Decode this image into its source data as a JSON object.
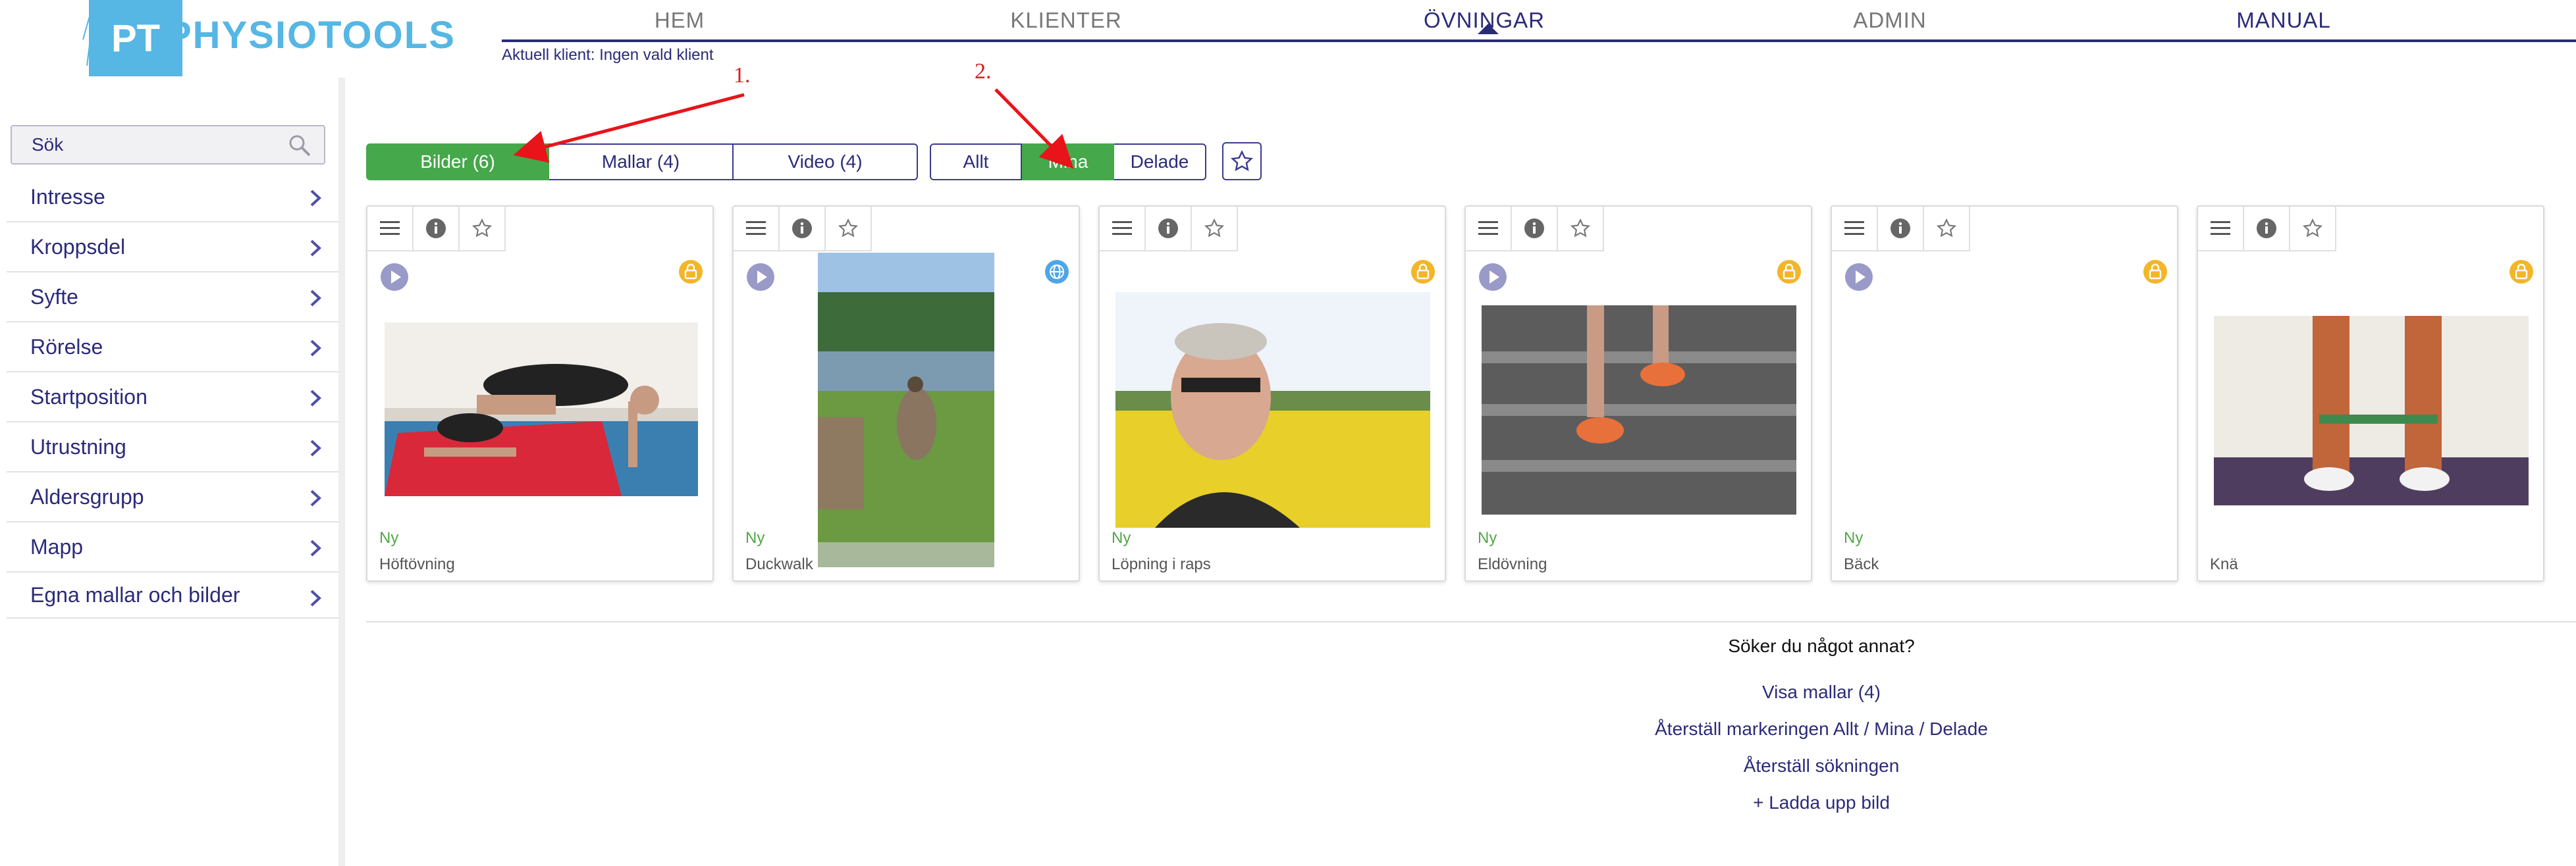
{
  "brand": {
    "logo_text": "PT",
    "name": "PHYSIOTOOLS"
  },
  "nav": {
    "items": [
      "HEM",
      "KLIENTER",
      "ÖVNINGAR",
      "ADMIN",
      "MANUAL"
    ],
    "active": "ÖVNINGAR"
  },
  "client_line": "Aktuell klient: Ingen vald klient",
  "search": {
    "label": "Sök"
  },
  "sidebar": {
    "items": [
      "Intresse",
      "Kroppsdel",
      "Syfte",
      "Rörelse",
      "Startposition",
      "Utrustning",
      "Aldersgrupp",
      "Mapp",
      "Egna mallar och bilder"
    ]
  },
  "media_tabs": [
    {
      "label": "Bilder (6)",
      "active": true
    },
    {
      "label": "Mallar (4)",
      "active": false
    },
    {
      "label": "Video (4)",
      "active": false
    }
  ],
  "owner_tabs": [
    {
      "label": "Allt",
      "active": false
    },
    {
      "label": "Mina",
      "active": true
    },
    {
      "label": "Delade",
      "active": false
    }
  ],
  "annotations": [
    "1.",
    "2."
  ],
  "cards": [
    {
      "title": "Höftövning",
      "tag": "Ny",
      "badge": "lock"
    },
    {
      "title": "Duckwalk",
      "tag": "Ny",
      "badge": "globe"
    },
    {
      "title": "Löpning i raps",
      "tag": "Ny",
      "badge": "lock"
    },
    {
      "title": "Eldövning",
      "tag": "Ny",
      "badge": "lock"
    },
    {
      "title": "Bäck",
      "tag": "Ny",
      "badge": "lock"
    },
    {
      "title": "Knä",
      "tag": "",
      "badge": "lock"
    }
  ],
  "bottom": {
    "question": "Söker du något annat?",
    "links": [
      "Visa mallar (4)",
      "Återställ markeringen Allt / Mina / Delade",
      "Återställ sökningen",
      "+ Ladda upp bild"
    ]
  },
  "colors": {
    "accent_green": "#45a84a",
    "navy": "#2b2b7a",
    "brand_blue": "#56b6e4",
    "lock_orange": "#f3b529",
    "annotation_red": "#d61e1e"
  }
}
